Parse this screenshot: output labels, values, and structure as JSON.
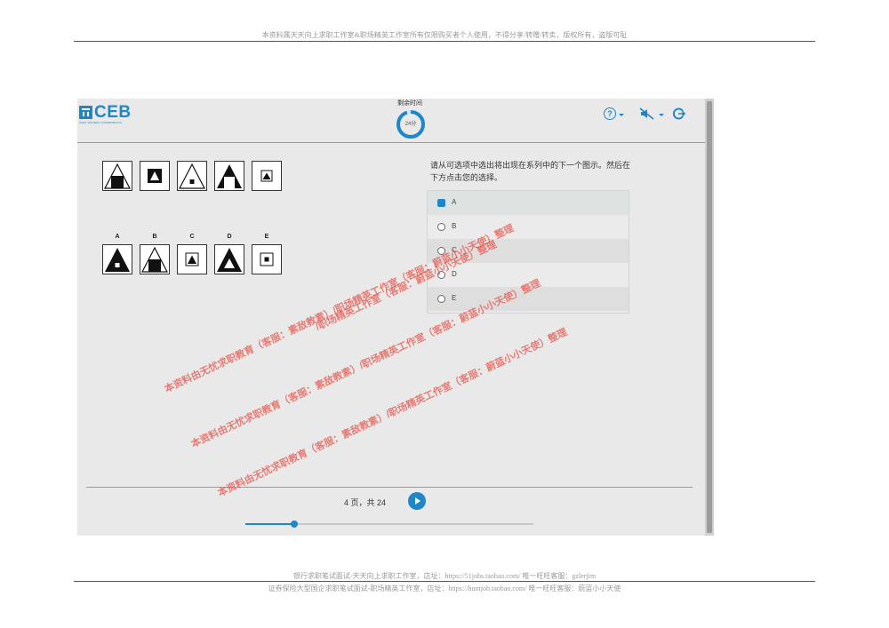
{
  "document": {
    "header_notice": "本资料属天天向上求职工作室&职场精英工作室所有仅限购买者个人使用，不得分享/转赠/转卖，版权所有，盗版可耻",
    "footer_line1": "银行求职笔试面试-天天向上求职工作室，店址：https://51jobs.taobao.com/ 唯一旺旺客服：gzlerjim",
    "footer_line2": "证券保险大型国企求职笔试面试-职场精英工作室，店址：https://huntjob.taobao.com/ 唯一旺旺客服：蔚蓝小小天使"
  },
  "app": {
    "logo_text": "CEB",
    "logo_tagline": "WHAT THE BEST COMPANIES DO",
    "timer_label": "剩余时间",
    "timer_value": "24分",
    "timer_fraction_remaining": 0.95,
    "icons": [
      "help-icon",
      "caret-down-icon",
      "sound-off-icon",
      "caret-down-icon",
      "exit-icon"
    ],
    "accent_color": "#1f86c8"
  },
  "question": {
    "instructions": "请从可选项中选出将出现在系列中的下一个图示。然后在下方点击您的选择。",
    "sequence": [
      "triangle-with-square-bottom",
      "square-with-triangle",
      "triangle-with-small-square",
      "triangle-with-white-square-bottom",
      "square-with-triangle-small"
    ],
    "option_letters": [
      "A",
      "B",
      "C",
      "D",
      "E"
    ],
    "answers": [
      {
        "label": "A",
        "selected": true
      },
      {
        "label": "B",
        "selected": false
      },
      {
        "label": "C",
        "selected": false
      },
      {
        "label": "D",
        "selected": false
      },
      {
        "label": "E",
        "selected": false
      }
    ]
  },
  "footer": {
    "page_text": "4 页，共 24",
    "progress_fraction": 0.17
  },
  "watermarks": [
    "/职场精英工作室（客服：蔚蓝小小天使）整理",
    "本资料由无忧求职教育（客服：素敌教素）/职场精英工作室（客服：蔚蓝小小天使）整理",
    "本资料由无忧求职教育（客服：素敌教素）/职场精英工作室（客服：蔚蓝小小天使）整理",
    "本资料由无忧求职教育（客服：素敌教素）/职场精英工作室（客服：蔚蓝小小天使）整理"
  ]
}
